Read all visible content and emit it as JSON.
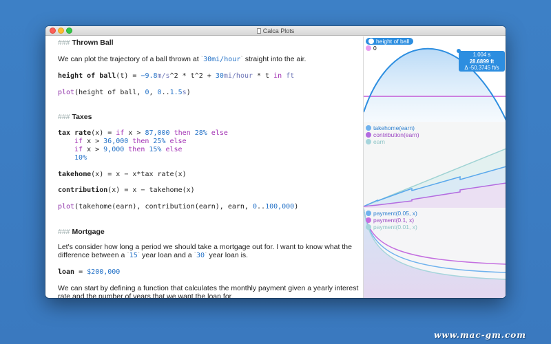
{
  "window": {
    "title": "Calca Plots"
  },
  "editor": {
    "thrown_ball": {
      "hash": "###",
      "heading": "Thrown Ball",
      "intro_before": "We can plot the trajectory of a ball thrown at ",
      "intro_value": "30",
      "intro_unit": "mi/hour",
      "intro_after": " straight into the air.",
      "eq_name": "height of ball",
      "eq_arg": "(t) = ",
      "eq_c1": "−9.8",
      "eq_u1": "m/s",
      "eq_p1": "^2 * t^2 + ",
      "eq_c2": "30",
      "eq_u2": "mi/hour",
      "eq_p2": " * t ",
      "eq_in": "in",
      "eq_u3": " ft",
      "plot_fn": "plot",
      "plot_args_a": "(height of ball, ",
      "plot_zero": "0",
      "plot_sep": ", ",
      "plot_range_a": "0",
      "plot_range_dots": "..",
      "plot_range_b": "1.5",
      "plot_range_unit": "s",
      "plot_close": ")"
    },
    "taxes": {
      "hash": "###",
      "heading": "Taxes",
      "l1_name": "tax rate",
      "l1_a": "(x) = ",
      "l1_if": "if",
      "l1_b": " x > ",
      "l1_num": "87,000",
      "l1_then": " then ",
      "l1_rate": "28%",
      "l1_else": " else",
      "l2_if": "if",
      "l2_b": " x > ",
      "l2_num": "36,000",
      "l2_then": " then ",
      "l2_rate": "25%",
      "l2_else": " else",
      "l3_if": "if",
      "l3_b": " x > ",
      "l3_num": "9,000",
      "l3_then": " then ",
      "l3_rate": "15%",
      "l3_else": " else",
      "l4_rate": "10%",
      "takehome_name": "takehome",
      "takehome_rest": "(x) = x − x*tax rate(x)",
      "contrib_name": "contribution",
      "contrib_rest": "(x) = x − takehome(x)",
      "plot_fn": "plot",
      "plot_args": "(takehome(earn), contribution(earn), earn, ",
      "plot_range_a": "0",
      "plot_range_dots": "..",
      "plot_range_b": "100,000",
      "plot_close": ")"
    },
    "mortgage": {
      "hash": "###",
      "heading": "Mortgage",
      "p1_a": "Let's consider how long a period we should take a mortgage out for. I want to know what the",
      "p1_b": "difference between a ",
      "p1_v1": "15",
      "p1_c": " year loan and a ",
      "p1_v2": "30",
      "p1_d": " year loan is.",
      "loan_name": "loan",
      "loan_eq": " = ",
      "loan_value": "$200,000",
      "p2_a": "We can start by defining a function that calculates the monthly payment given a yearly interest",
      "p2_b": "rate and the number of years that we want the loan for."
    }
  },
  "plots": {
    "height": {
      "legend": [
        "height of ball",
        "0"
      ],
      "colors": [
        "#2d8ee0",
        "#c35bd6"
      ],
      "tooltip": {
        "time": "1.004 s",
        "value": "28.6899 ft",
        "delta": "Δ -50.3745 ft/s"
      }
    },
    "taxes": {
      "legend": [
        "takehome(earn)",
        "contribution(earn)",
        "earn"
      ],
      "colors": [
        "#5aa8ec",
        "#b36be0",
        "#9fd3d4"
      ]
    },
    "mortgage": {
      "legend": [
        "payment(0.05, x)",
        "payment(0.1, x)",
        "payment(0.01, x)"
      ],
      "colors": [
        "#6fb2ee",
        "#c46fe0",
        "#a6d5dc"
      ]
    }
  },
  "watermark": "www.mac-gm.com"
}
